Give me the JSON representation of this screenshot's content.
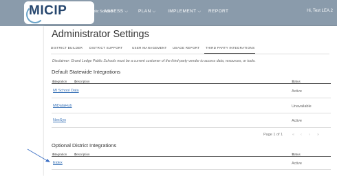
{
  "header": {
    "logo": "MICIP",
    "district": "Grand Ledge Public Schools",
    "nav": [
      {
        "label": "ASSESS"
      },
      {
        "label": "PLAN"
      },
      {
        "label": "IMPLEMENT"
      },
      {
        "label": "REPORT"
      }
    ],
    "user": "Hi, Test LEA.2"
  },
  "page": {
    "title": "Administrator Settings",
    "tabs": [
      "DISTRICT BUILDER",
      "DISTRICT SUPPORT",
      "USER MANAGEMENT",
      "USAGE REPORT",
      "THIRD PARTY INTEGRATIONS"
    ],
    "active_tab": "THIRD PARTY INTEGRATIONS",
    "disclaimer": "Disclaimer: Grand Ledge Public Schools must be a current customer of the third-party vendor to access data, resources, or tools."
  },
  "default_section": {
    "title": "Default Statewide Integrations",
    "columns": {
      "integration": "Integration",
      "description": "Description",
      "status": "Status"
    },
    "rows": [
      {
        "name": "MI School Data",
        "status": "Active"
      },
      {
        "name": "MiDataHub",
        "status": "Unavailable"
      },
      {
        "name": "NexSys",
        "status": "Active"
      }
    ],
    "pagination": "Page 1 of 1"
  },
  "optional_section": {
    "title": "Optional District Integrations",
    "columns": {
      "integration": "Integration",
      "description": "Description",
      "status": "Status"
    },
    "rows": [
      {
        "name": "Eidex",
        "status": "Active"
      }
    ]
  },
  "colors": {
    "topbar": "#8a9bab",
    "link": "#3b74b8",
    "arrow": "#3b6fc4"
  }
}
